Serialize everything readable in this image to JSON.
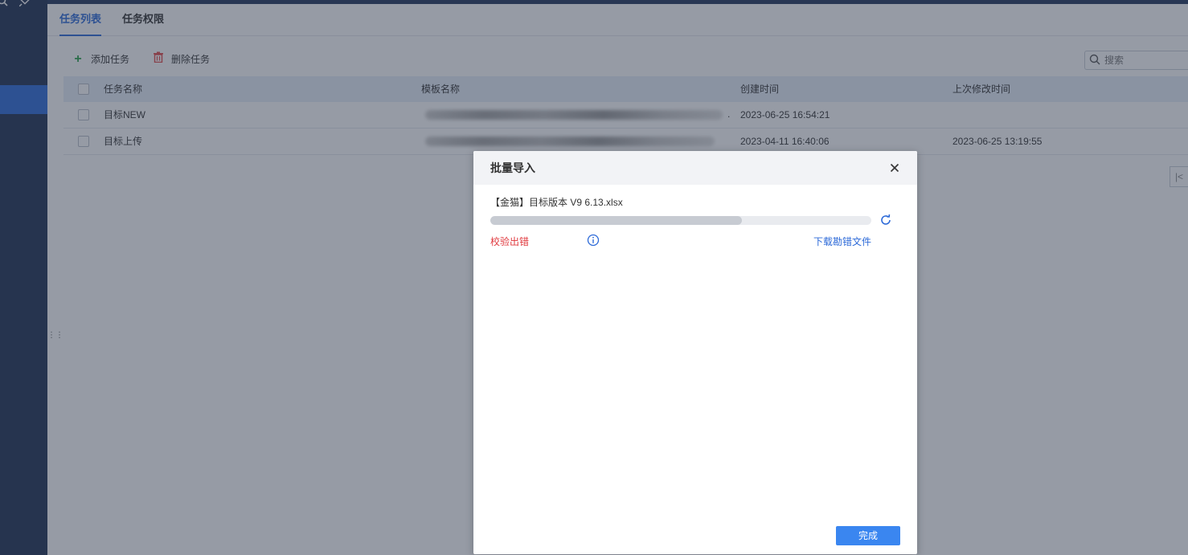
{
  "sidebar": {
    "icons": [
      "search-icon",
      "pin-icon"
    ]
  },
  "tabs": [
    {
      "label": "任务列表",
      "active": true
    },
    {
      "label": "任务权限",
      "active": false
    }
  ],
  "toolbar": {
    "add_label": "添加任务",
    "delete_label": "删除任务"
  },
  "search": {
    "placeholder": "搜索"
  },
  "table": {
    "columns": [
      "任务名称",
      "模板名称",
      "创建时间",
      "上次修改时间"
    ],
    "rows": [
      {
        "name": "目标NEW",
        "template": "",
        "created": "2023-06-25 16:54:21",
        "modified": ""
      },
      {
        "name": "目标上传",
        "template": "",
        "created": "2023-04-11 16:40:06",
        "modified": "2023-06-25 13:19:55"
      }
    ]
  },
  "modal": {
    "title": "批量导入",
    "file_name": "【金猫】目标版本 V9 6.13.xlsx",
    "progress": 0.66,
    "status": "校验出错",
    "download_label": "下载勘错文件",
    "done_label": "完成"
  },
  "colors": {
    "accent": "#2d6ad8",
    "error": "#e0393e",
    "sidebar_bg": "#1f3052",
    "button_bg": "#3a86f0"
  }
}
